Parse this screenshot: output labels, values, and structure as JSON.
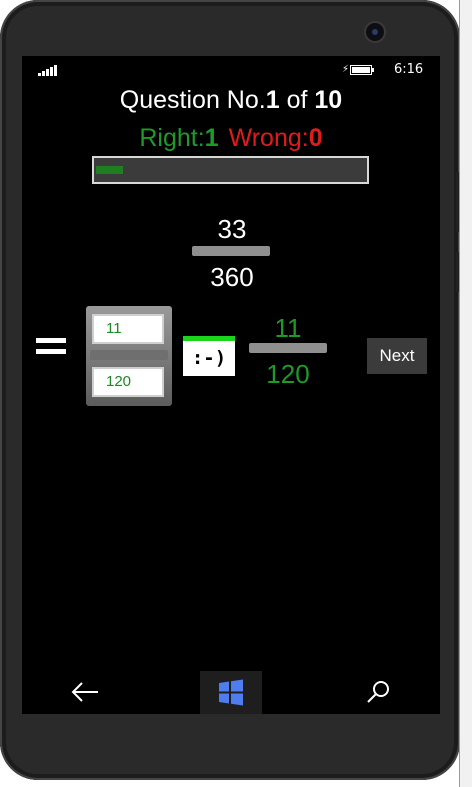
{
  "status_bar": {
    "time": "6:16"
  },
  "question": {
    "prefix": "Question No.",
    "current": "1",
    "of_label": "of",
    "total": "10"
  },
  "score": {
    "right_label": "Right:",
    "right_value": "1",
    "wrong_label": "Wrong:",
    "wrong_value": "0"
  },
  "progress": {
    "fraction": 0.1
  },
  "problem": {
    "numerator": "33",
    "denominator": "360"
  },
  "equals_symbol": "=",
  "answer_inputs": {
    "numerator_value": "11",
    "denominator_value": "120"
  },
  "feedback": {
    "text": ":-)"
  },
  "simplified": {
    "numerator": "11",
    "denominator": "120"
  },
  "next_button": {
    "label": "Next"
  },
  "colors": {
    "right": "#1f9a2a",
    "wrong": "#e11b1b",
    "progress_fill": "#1e7f21",
    "feedback_accent": "#1bd51b"
  },
  "icons": {
    "back": "back-arrow-icon",
    "home": "windows-logo-icon",
    "search": "search-icon"
  }
}
